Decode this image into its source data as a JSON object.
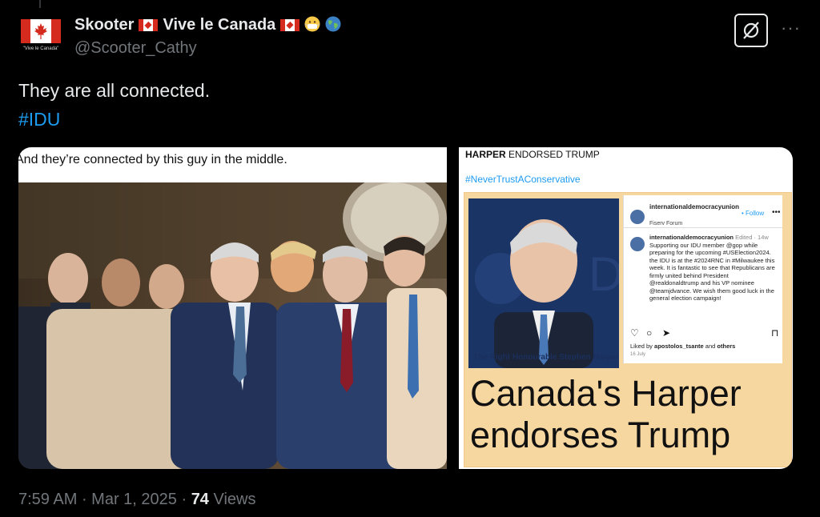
{
  "author": {
    "display_name": "Skooter",
    "name_suffix": "Vive le Canada",
    "handle": "@Scooter_Cathy",
    "avatar_caption": "\"Vive le Canada\""
  },
  "tweet": {
    "text": "They are all connected.",
    "hashtag": "#IDU"
  },
  "media": {
    "left": {
      "caption": "And they’re connected by this guy in the middle."
    },
    "right": {
      "title_bold": "HARPER",
      "title_rest": " ENDORSED TRUMP",
      "hashtag": "#NeverTrustAConservative",
      "photo_caption": "The Right Honourable Stephen Harper",
      "instagram": {
        "account": "internationaldemocracyunion",
        "follow": "• Follow",
        "location": "Fiserv Forum",
        "post_user": "internationaldemocracyunion",
        "edited": "Edited · 14w",
        "post_text": "Supporting our IDU member @gop while preparing for the upcoming #USElection2024. the IDU is at the #2024RNC in #Milwaukee this week. It is fantastic to see that Republicans are firmly united behind President @realdonaldtrump and his VP nominee @teamjdvance. We wish them good luck in the general election campaign!",
        "liked_prefix": "Liked by ",
        "liked_user": "apostolos_tsante",
        "liked_mid": " and ",
        "liked_others": "others",
        "date": "16 July"
      },
      "headline": "Canada's Harper endorses Trump"
    }
  },
  "footer": {
    "time": "7:59 AM",
    "sep1": " · ",
    "date": "Mar 1, 2025",
    "sep2": " · ",
    "views_count": "74",
    "views_label": " Views"
  },
  "icons": {
    "grok": "grok-icon",
    "more": "more-icon"
  },
  "colors": {
    "background": "#000000",
    "text": "#e7e9ea",
    "secondary": "#71767b",
    "link": "#1d9bf0",
    "canada_red": "#d52b1e"
  }
}
